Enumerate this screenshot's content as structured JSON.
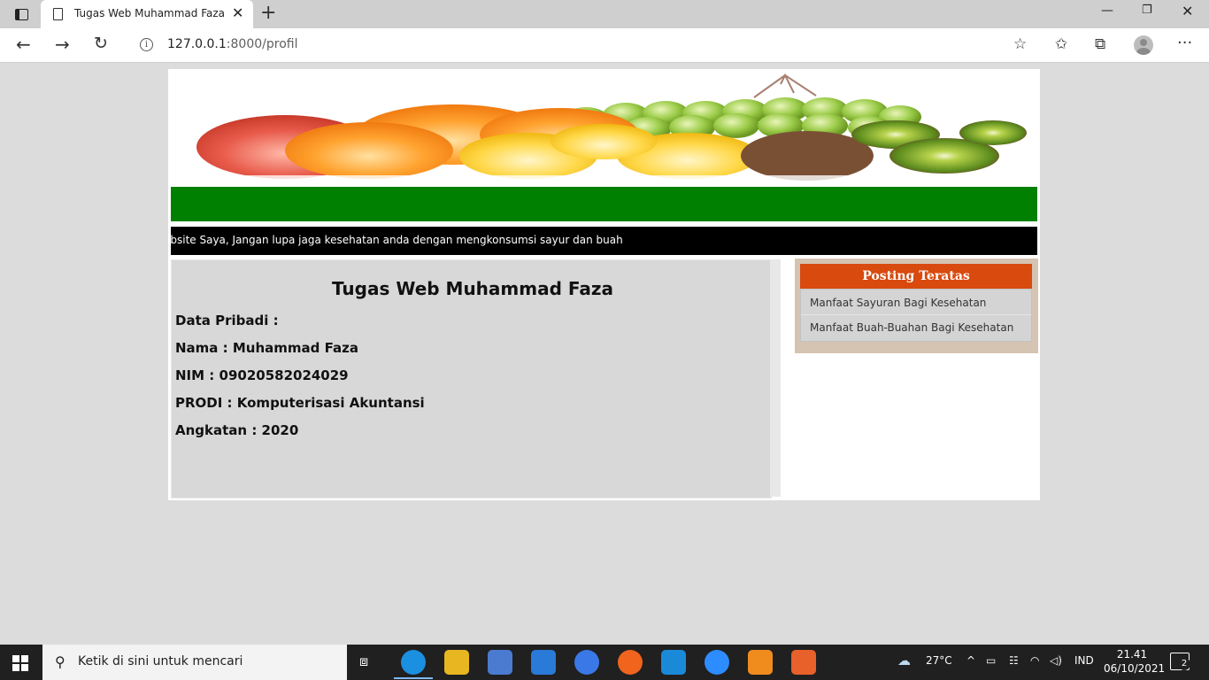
{
  "browser": {
    "tab_title": "Tugas Web Muhammad Faza",
    "url_host": "127.0.0.1",
    "url_rest": ":8000/profil"
  },
  "page": {
    "marquee_text": "ebsite Saya, Jangan lupa jaga kesehatan anda dengan mengkonsumsi sayur dan buah",
    "heading": "Tugas Web Muhammad Faza",
    "lines": [
      "Data Pribadi :",
      "Nama : Muhammad Faza",
      "NIM : 09020582024029",
      "PRODI : Komputerisasi Akuntansi",
      "Angkatan : 2020"
    ],
    "sidebar": {
      "title": "Posting Teratas",
      "items": [
        "Manfaat Sayuran Bagi Kesehatan",
        "Manfaat Buah-Buahan Bagi Kesehatan"
      ]
    }
  },
  "taskbar": {
    "search_placeholder": "Ketik di sini untuk mencari",
    "weather": "27°C",
    "language": "IND",
    "time": "21.41",
    "date": "06/10/2021",
    "notifications": "2"
  },
  "colors": {
    "green_bar": "#008000",
    "sidebar_header": "#d84a0e",
    "sidebar_bg": "#d5c4b1"
  }
}
